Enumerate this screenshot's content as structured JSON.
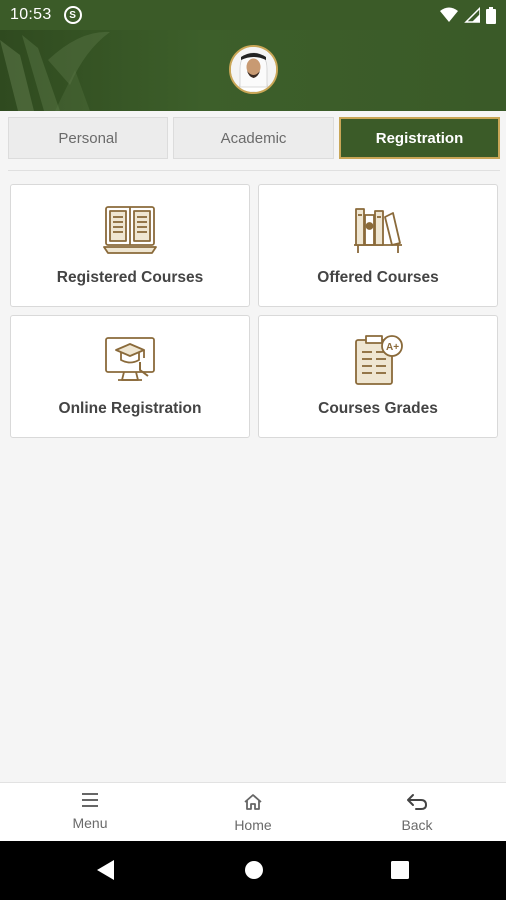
{
  "status_bar": {
    "time": "10:53",
    "sync_glyph": "S",
    "icons": [
      "sync-icon",
      "wifi-icon",
      "signal-icon",
      "battery-icon"
    ]
  },
  "header": {
    "avatar_icon": "user-avatar"
  },
  "tabs": [
    {
      "label": "Personal",
      "active": false
    },
    {
      "label": "Academic",
      "active": false
    },
    {
      "label": "Registration",
      "active": true
    }
  ],
  "cards": [
    {
      "label": "Registered Courses",
      "icon": "book-icon"
    },
    {
      "label": "Offered Courses",
      "icon": "bookshelf-icon"
    },
    {
      "label": "Online Registration",
      "icon": "graduation-computer-icon"
    },
    {
      "label": "Courses Grades",
      "icon": "grade-report-icon"
    }
  ],
  "bottom_nav": {
    "menu_label": "Menu",
    "home_label": "Home",
    "back_label": "Back"
  },
  "colors": {
    "primary_green": "#3b5b28",
    "gold_accent": "#c9a657",
    "icon_brown": "#8a6a3a"
  }
}
